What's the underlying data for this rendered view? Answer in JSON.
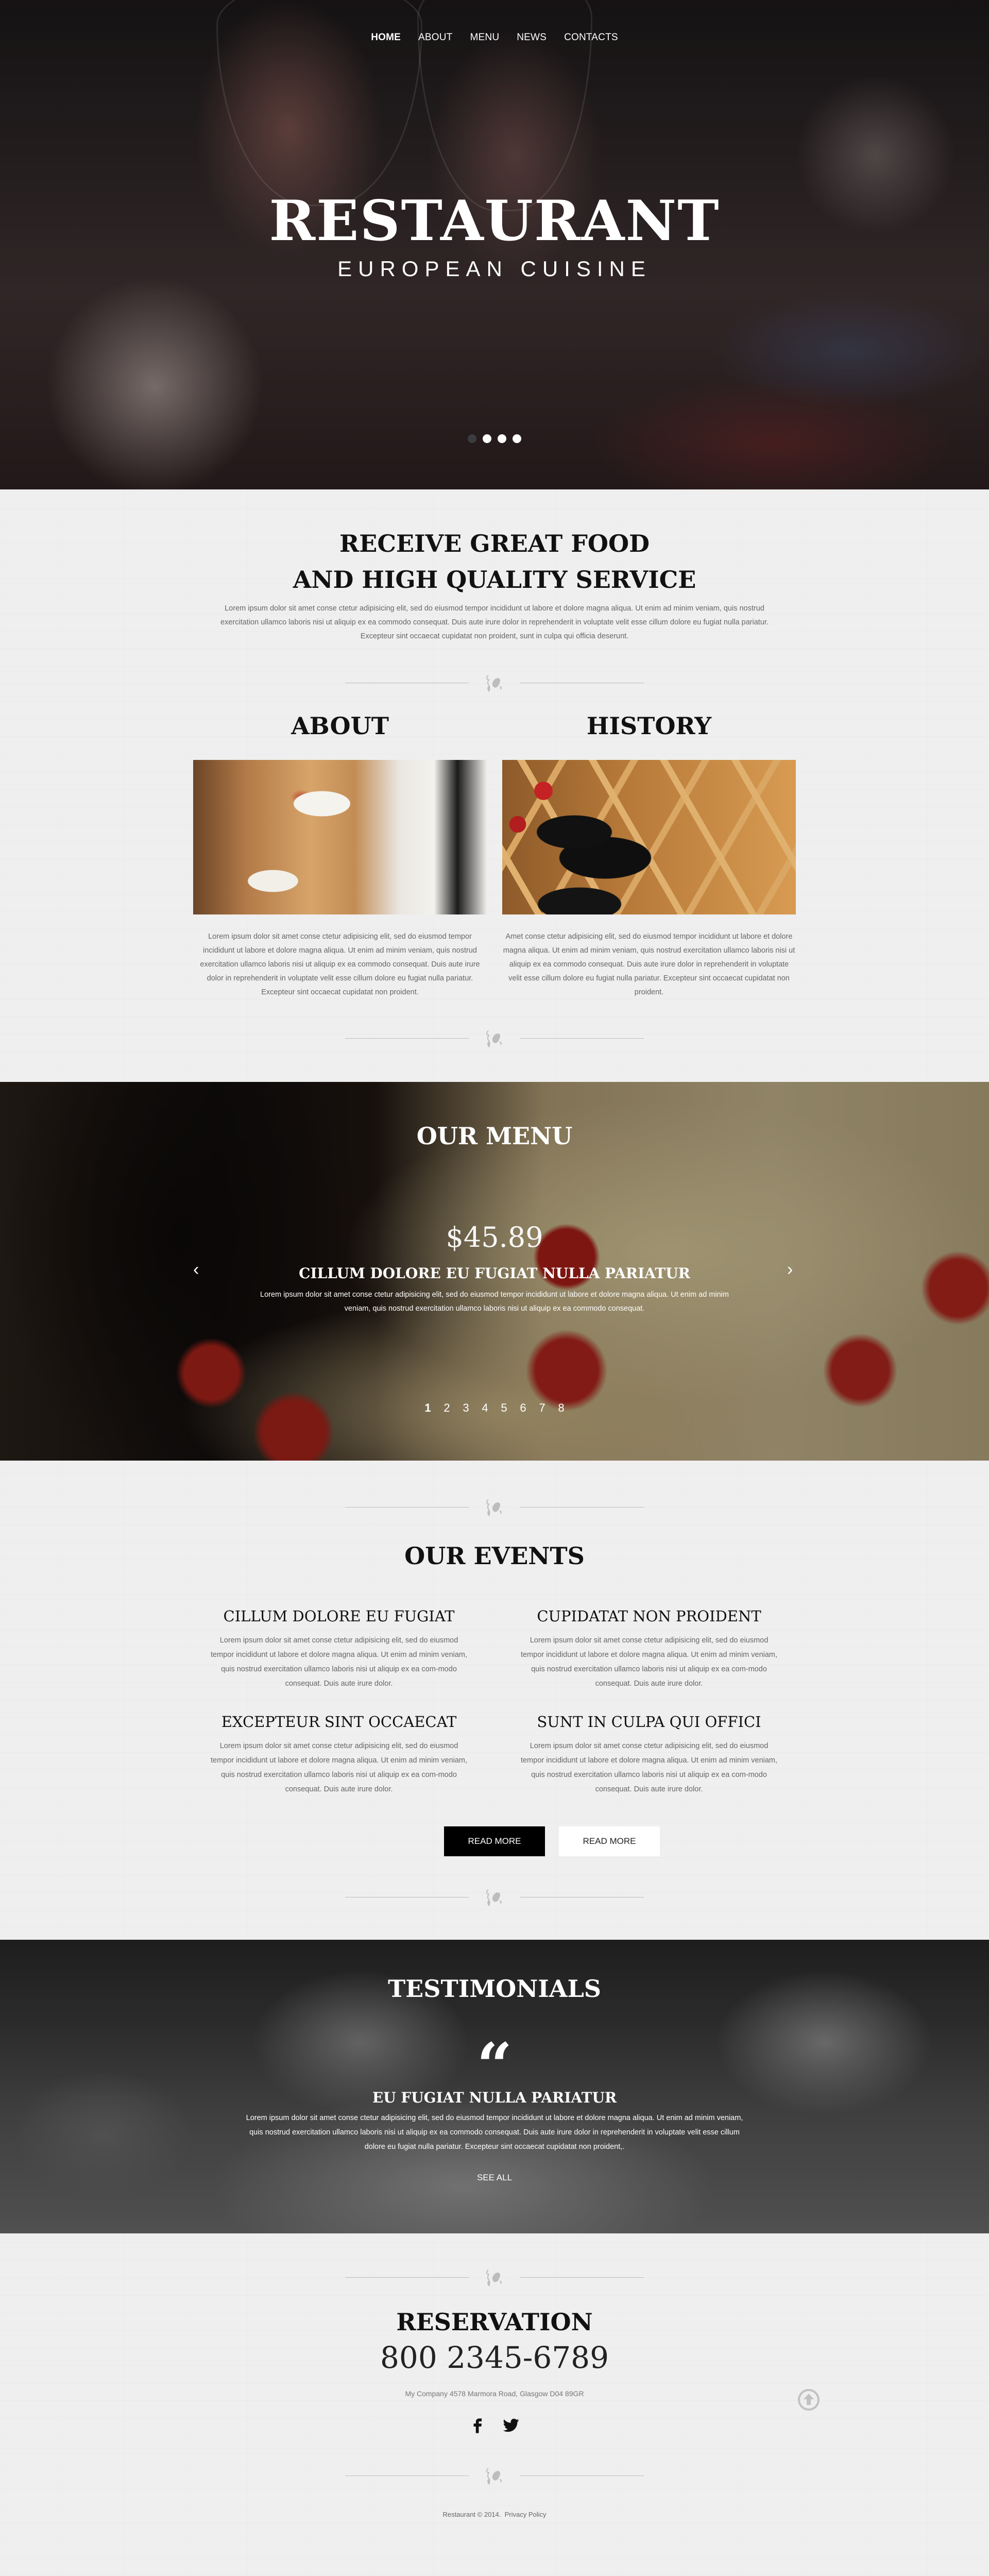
{
  "nav": {
    "items": [
      {
        "label": "HOME",
        "active": true
      },
      {
        "label": "ABOUT",
        "active": false
      },
      {
        "label": "MENU",
        "active": false
      },
      {
        "label": "NEWS",
        "active": false
      },
      {
        "label": "CONTACTS",
        "active": false
      }
    ]
  },
  "hero": {
    "title": "RESTAURANT",
    "subtitle": "EUROPEAN CUISINE",
    "slides_total": 4,
    "slide_active": 1
  },
  "intro": {
    "title_line1": "RECEIVE GREAT FOOD",
    "title_line2": "AND HIGH QUALITY SERVICE",
    "text": "Lorem ipsum dolor sit amet conse ctetur adipisicing elit, sed do eiusmod tempor incididunt ut labore et dolore magna aliqua. Ut enim ad minim veniam, quis nostrud exercitation ullamco laboris nisi ut aliquip ex ea commodo consequat. Duis aute irure dolor in reprehenderit in voluptate velit esse cillum dolore eu fugiat nulla pariatur. Excepteur sint occaecat cupidatat non proident, sunt in culpa qui officia deserunt."
  },
  "about": {
    "title": "ABOUT",
    "image_alt": "Waiter carrying plates",
    "text": "Lorem ipsum dolor sit amet conse ctetur adipisicing elit, sed do eiusmod tempor incididunt ut labore et dolore magna aliqua. Ut enim ad minim veniam, quis nostrud exercitation ullamco laboris nisi ut aliquip ex ea commodo consequat. Duis aute irure dolor in reprehenderit in voluptate velit esse cillum dolore eu fugiat nulla pariatur. Excepteur sint occaecat cupidatat non proident."
  },
  "history": {
    "title": "HISTORY",
    "image_alt": "Wine bottles on rack",
    "text": "Amet conse ctetur adipisicing elit, sed do eiusmod tempor incididunt ut labore et dolore magna aliqua. Ut enim ad minim veniam, quis nostrud exercitation ullamco laboris nisi ut aliquip ex ea commodo consequat. Duis aute irure dolor in reprehenderit in voluptate velit esse cillum dolore eu fugiat nulla pariatur. Excepteur sint occaecat cupidatat non proident."
  },
  "menu": {
    "title": "OUR MENU",
    "price": "$45.89",
    "item_title": "CILLUM DOLORE EU FUGIAT NULLA PARIATUR",
    "item_text": "Lorem ipsum dolor sit amet conse ctetur adipisicing elit, sed do eiusmod tempor incididunt ut labore et dolore magna aliqua. Ut enim ad minim veniam, quis nostrud exercitation ullamco laboris nisi ut aliquip ex ea commodo consequat.",
    "prev_icon": "‹",
    "next_icon": "›",
    "pages": [
      "1",
      "2",
      "3",
      "4",
      "5",
      "6",
      "7",
      "8"
    ],
    "active_page": "1"
  },
  "events": {
    "title": "OUR EVENTS",
    "items": [
      {
        "title": "CILLUM DOLORE EU FUGIAT",
        "text": "Lorem ipsum dolor sit amet conse ctetur adipisicing elit, sed do eiusmod tempor incididunt ut labore et dolore magna aliqua. Ut enim ad minim veniam, quis nostrud exercitation ullamco laboris nisi ut aliquip ex ea com-modo consequat. Duis aute irure dolor."
      },
      {
        "title": "CUPIDATAT NON PROIDENT",
        "text": "Lorem ipsum dolor sit amet conse ctetur adipisicing elit, sed do eiusmod tempor incididunt ut labore et dolore magna aliqua. Ut enim ad minim veniam, quis nostrud exercitation ullamco laboris nisi ut aliquip ex ea com-modo consequat. Duis aute irure dolor."
      },
      {
        "title": "EXCEPTEUR SINT OCCAECAT",
        "text": "Lorem ipsum dolor sit amet conse ctetur adipisicing elit, sed do eiusmod tempor incididunt ut labore et dolore magna aliqua. Ut enim ad minim veniam, quis nostrud exercitation ullamco laboris nisi ut aliquip ex ea com-modo consequat. Duis aute irure dolor."
      },
      {
        "title": "SUNT IN CULPA QUI OFFICI",
        "text": "Lorem ipsum dolor sit amet conse ctetur adipisicing elit, sed do eiusmod tempor incididunt ut labore et dolore magna aliqua. Ut enim ad minim veniam, quis nostrud exercitation ullamco laboris nisi ut aliquip ex ea com-modo consequat. Duis aute irure dolor."
      }
    ],
    "button_primary": "READ MORE",
    "button_secondary": "READ MORE"
  },
  "testimonials": {
    "title": "TESTIMONIALS",
    "quote_mark": "“",
    "subtitle": "EU FUGIAT NULLA PARIATUR",
    "text": "Lorem ipsum dolor sit amet conse ctetur adipisicing elit, sed do eiusmod tempor incididunt ut labore et dolore magna aliqua. Ut enim ad minim veniam, quis nostrud exercitation ullamco laboris nisi ut aliquip ex ea commodo consequat. Duis aute irure dolor in reprehenderit in voluptate velit esse cillum dolore eu fugiat nulla pariatur. Excepteur sint occaecat cupidatat non proident,.",
    "see_all": "SEE ALL"
  },
  "reservation": {
    "title": "RESERVATION",
    "phone": "800 2345-6789",
    "address": "My Company 4578 Marmora Road, Glasgow D04 89GR",
    "social": [
      "facebook-icon",
      "twitter-icon"
    ]
  },
  "footer": {
    "copyright": "Restaurant © 2014.",
    "privacy": "Privacy Policy"
  },
  "colors": {
    "background": "#efefef",
    "text_dark": "#111111",
    "text_body": "#666666",
    "button_dark": "#000000",
    "button_light": "#ffffff",
    "ornament": "#bdbdbd"
  }
}
